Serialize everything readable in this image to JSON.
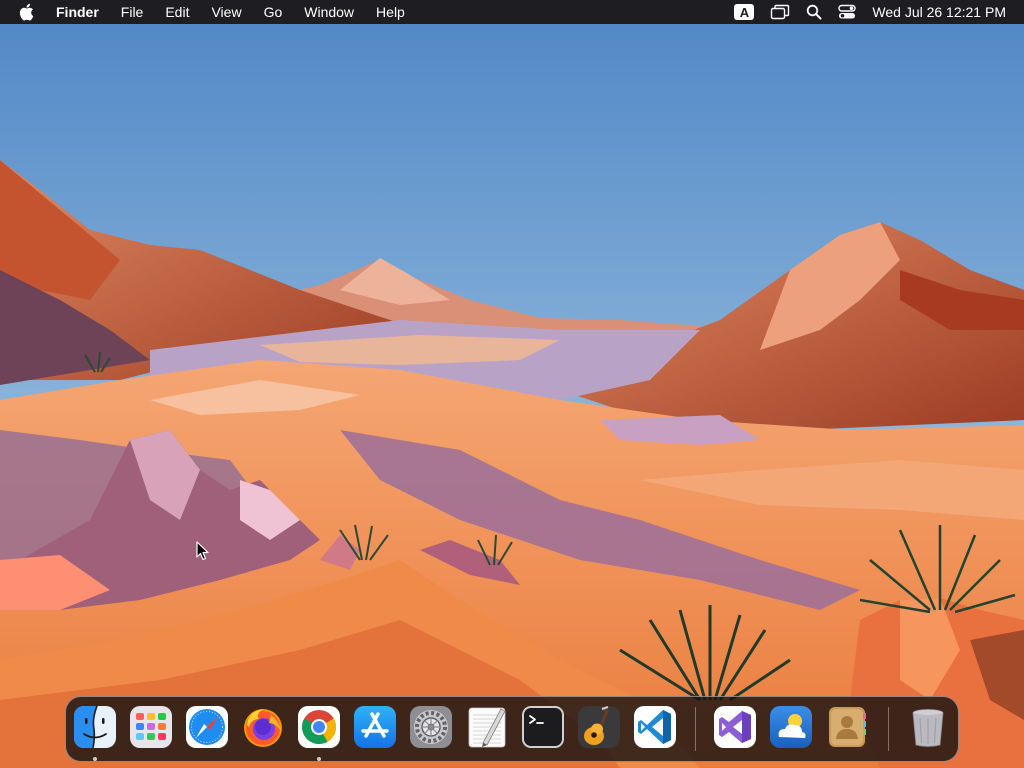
{
  "menubar": {
    "app_name": "Finder",
    "menus": [
      "File",
      "Edit",
      "View",
      "Go",
      "Window",
      "Help"
    ],
    "input_source": "A",
    "clock": "Wed Jul 26  12:21 PM",
    "icons": [
      "apple-logo-icon",
      "input-source-icon",
      "screen-mirroring-icon",
      "spotlight-search-icon",
      "control-center-icon"
    ]
  },
  "dock": {
    "apps": [
      {
        "name": "Finder",
        "icon": "finder-icon",
        "running": true
      },
      {
        "name": "Launchpad",
        "icon": "launchpad-icon",
        "running": false
      },
      {
        "name": "Safari",
        "icon": "safari-icon",
        "running": false
      },
      {
        "name": "Firefox",
        "icon": "firefox-icon",
        "running": false
      },
      {
        "name": "Google Chrome",
        "icon": "chrome-icon",
        "running": true
      },
      {
        "name": "App Store",
        "icon": "app-store-icon",
        "running": false
      },
      {
        "name": "System Settings",
        "icon": "system-settings-icon",
        "running": false
      },
      {
        "name": "TextEdit",
        "icon": "textedit-icon",
        "running": false
      },
      {
        "name": "Terminal",
        "icon": "terminal-icon",
        "running": false
      },
      {
        "name": "GarageBand",
        "icon": "garageband-icon",
        "running": false
      },
      {
        "name": "Visual Studio Code",
        "icon": "vscode-icon",
        "running": false
      }
    ],
    "recent_apps": [
      {
        "name": "Visual Studio",
        "icon": "visual-studio-icon",
        "running": false
      },
      {
        "name": "Weather",
        "icon": "weather-icon",
        "running": false
      },
      {
        "name": "Contacts",
        "icon": "contacts-icon",
        "running": false
      }
    ],
    "trash": {
      "name": "Trash",
      "icon": "trash-icon"
    }
  },
  "colors": {
    "menubar_bg": "#1e1e22",
    "sky_top": "#4f86c6",
    "sky_bottom": "#a8c8e0",
    "sand": "#f0955a",
    "rock": "#b84a2c"
  }
}
